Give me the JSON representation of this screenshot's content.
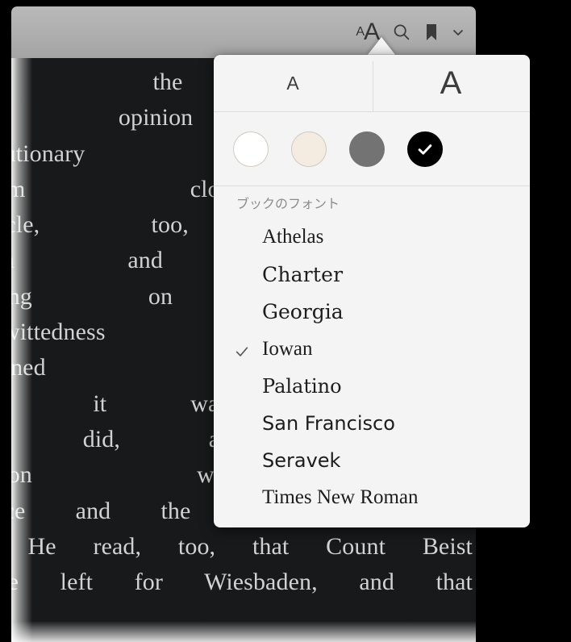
{
  "toolbar": {
    "font_size_small_label": "A",
    "font_size_large_label": "A",
    "search_icon": "search-icon",
    "bookmark_icon": "bookmark-icon",
    "chevron_icon": "chevron-down-icon"
  },
  "book": {
    "text": "sh the revolutionary\nour opinion the da\nvolutionary hydra, b\nalism clogging pro\narticle, too, a finan\nham and Mill, and\necting on the min\nickwittedness he ca\ndivined whence it\nund it was aimed, a\nys did, a certain s\naction was embitte\ndvice and the unsatisfactory state\nd. He read, too, that Count Beist\nhave left for Wiesbaden, and that"
  },
  "popover": {
    "decrease_font_label": "A",
    "increase_font_label": "A",
    "themes": [
      {
        "name": "white",
        "color": "#ffffff",
        "selected": false
      },
      {
        "name": "sepia",
        "color": "#f4ece0",
        "selected": false
      },
      {
        "name": "gray",
        "color": "#737373",
        "selected": false
      },
      {
        "name": "black",
        "color": "#000000",
        "selected": true
      }
    ],
    "fonts_section_title": "ブックのフォント",
    "fonts": [
      {
        "label": "Athelas",
        "selected": false
      },
      {
        "label": "Charter",
        "selected": false
      },
      {
        "label": "Georgia",
        "selected": false
      },
      {
        "label": "Iowan",
        "selected": true
      },
      {
        "label": "Palatino",
        "selected": false
      },
      {
        "label": "San Francisco",
        "selected": false
      },
      {
        "label": "Seravek",
        "selected": false
      },
      {
        "label": "Times New Roman",
        "selected": false
      }
    ]
  },
  "colors": {
    "popover_background": "#f4f4f4",
    "page_background": "#18191a",
    "page_text": "#d2d2d2",
    "toolbar_background": "#aeaeae",
    "section_header_text": "#8c8c8c"
  }
}
